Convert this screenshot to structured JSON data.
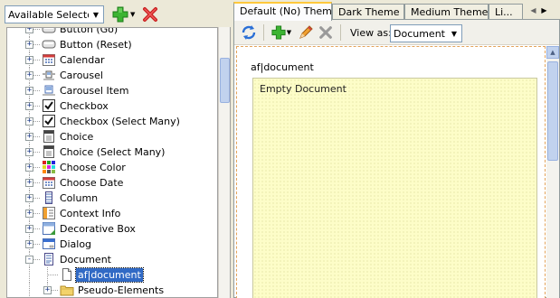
{
  "left_toolbar": {
    "selector_value": "Available Selectors",
    "add_icon": "green-plus-icon",
    "delete_icon": "red-x-icon"
  },
  "tree": {
    "items": [
      {
        "label": "Button (Go)",
        "icon": "button-icon",
        "level": 1,
        "expander": "+"
      },
      {
        "label": "Button (Reset)",
        "icon": "button-icon",
        "level": 1,
        "expander": "+"
      },
      {
        "label": "Calendar",
        "icon": "calendar-icon",
        "level": 1,
        "expander": "+"
      },
      {
        "label": "Carousel",
        "icon": "carousel-icon",
        "level": 1,
        "expander": "+"
      },
      {
        "label": "Carousel Item",
        "icon": "carousel-item-icon",
        "level": 1,
        "expander": "+"
      },
      {
        "label": "Checkbox",
        "icon": "checkbox-icon",
        "level": 1,
        "expander": "+"
      },
      {
        "label": "Checkbox (Select Many)",
        "icon": "checkbox-icon",
        "level": 1,
        "expander": "+"
      },
      {
        "label": "Choice",
        "icon": "choice-icon",
        "level": 1,
        "expander": "+"
      },
      {
        "label": "Choice (Select Many)",
        "icon": "choice-icon",
        "level": 1,
        "expander": "+"
      },
      {
        "label": "Choose Color",
        "icon": "color-grid-icon",
        "level": 1,
        "expander": "+"
      },
      {
        "label": "Choose Date",
        "icon": "calendar-icon",
        "level": 1,
        "expander": "+"
      },
      {
        "label": "Column",
        "icon": "column-icon",
        "level": 1,
        "expander": "+"
      },
      {
        "label": "Context Info",
        "icon": "context-info-icon",
        "level": 1,
        "expander": "+"
      },
      {
        "label": "Decorative Box",
        "icon": "decorative-box-icon",
        "level": 1,
        "expander": "+"
      },
      {
        "label": "Dialog",
        "icon": "dialog-icon",
        "level": 1,
        "expander": "+"
      },
      {
        "label": "Document",
        "icon": "document-icon",
        "level": 1,
        "expander": "-"
      },
      {
        "label": "af|document",
        "icon": "page-icon",
        "level": 2,
        "expander": "",
        "selected": true
      },
      {
        "label": "Pseudo-Elements",
        "icon": "folder-icon",
        "level": 2,
        "expander": "+"
      }
    ]
  },
  "tabs": [
    {
      "label": "Default (No) Theme",
      "active": true
    },
    {
      "label": "Dark Theme",
      "active": false
    },
    {
      "label": "Medium Theme",
      "active": false
    },
    {
      "label": "Li...",
      "active": false
    }
  ],
  "editor_toolbar": {
    "view_as_label": "View as:",
    "view_as_value": "Document"
  },
  "preview": {
    "path": "af|document",
    "content": "Empty Document"
  },
  "colors": {
    "selection": "#316ac5",
    "tab_highlight": "#ffc83c",
    "document_fill": "#fdfdc8"
  }
}
